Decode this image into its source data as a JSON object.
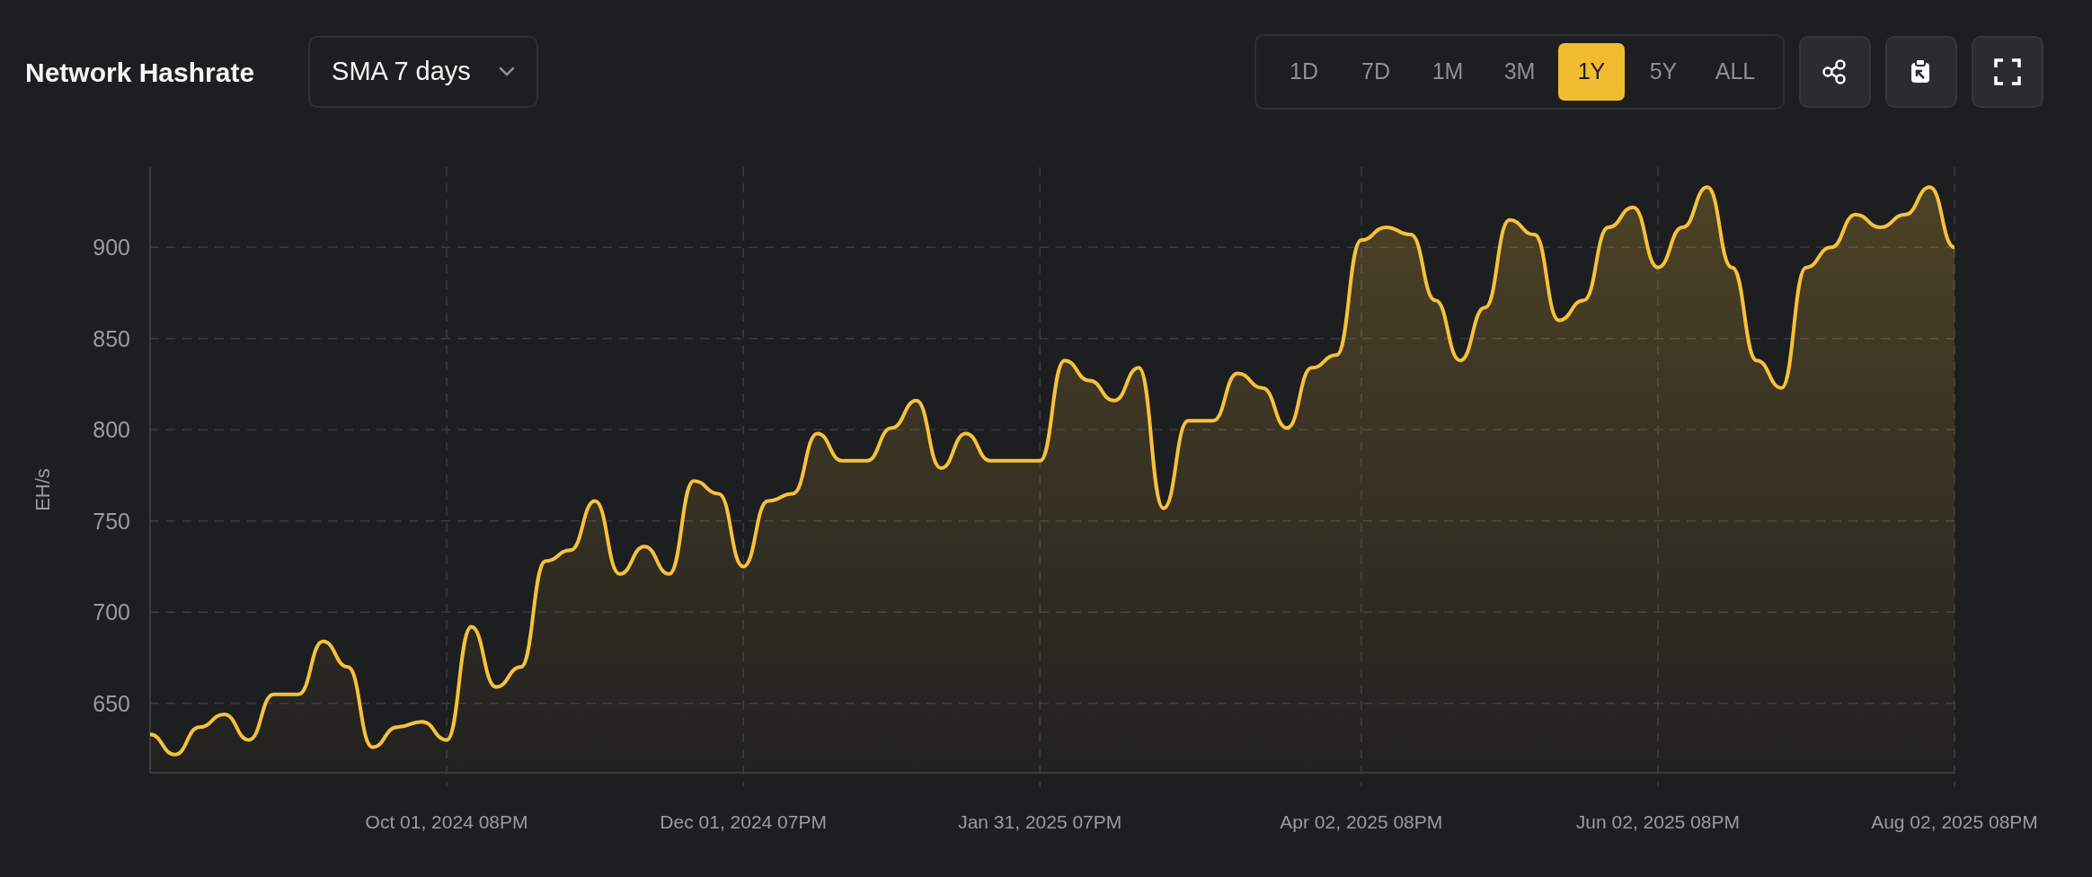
{
  "title": "Network Hashrate",
  "dropdown": {
    "value": "SMA 7 days"
  },
  "ranges": [
    {
      "label": "1D",
      "selected": false
    },
    {
      "label": "7D",
      "selected": false
    },
    {
      "label": "1M",
      "selected": false
    },
    {
      "label": "3M",
      "selected": false
    },
    {
      "label": "1Y",
      "selected": true
    },
    {
      "label": "5Y",
      "selected": false
    },
    {
      "label": "ALL",
      "selected": false
    }
  ],
  "actions": [
    {
      "kind": "share"
    },
    {
      "kind": "clipboard"
    },
    {
      "kind": "fullscreen"
    }
  ],
  "chart_data": {
    "type": "area",
    "ylabel": "EH/s",
    "categories": [
      null,
      null,
      null,
      null,
      null,
      null,
      null,
      null,
      null,
      null,
      null,
      null,
      "Oct 01, 2024 08PM",
      null,
      null,
      null,
      null,
      null,
      null,
      null,
      null,
      null,
      null,
      null,
      "Dec 01, 2024 07PM",
      null,
      null,
      null,
      null,
      null,
      null,
      null,
      null,
      null,
      null,
      null,
      "Jan 31, 2025 07PM",
      null,
      null,
      null,
      null,
      null,
      null,
      null,
      null,
      null,
      null,
      null,
      null,
      "Apr 02, 2025 08PM",
      null,
      null,
      null,
      null,
      null,
      null,
      null,
      null,
      null,
      null,
      null,
      "Jun 02, 2025 08PM",
      null,
      null,
      null,
      null,
      null,
      null,
      null,
      null,
      null,
      null,
      null,
      "Aug 02, 2025 08PM"
    ],
    "series": [
      {
        "color": "#f7c13a",
        "values": [
          633,
          622,
          637,
          644,
          630,
          655,
          655,
          684,
          670,
          626,
          637,
          640,
          630,
          692,
          659,
          670,
          728,
          734,
          761,
          721,
          736,
          721,
          772,
          765,
          725,
          761,
          765,
          798,
          783,
          783,
          801,
          816,
          779,
          798,
          783,
          783,
          783,
          838,
          827,
          816,
          834,
          757,
          805,
          805,
          831,
          823,
          801,
          834,
          841,
          904,
          911,
          907,
          871,
          838,
          867,
          915,
          907,
          860,
          871,
          911,
          922,
          889,
          911,
          933,
          889,
          838,
          823,
          889,
          900,
          918,
          911,
          918,
          933,
          900
        ]
      }
    ],
    "ylim": [
      612,
      944
    ],
    "grid": true,
    "yticks": [
      650,
      700,
      750,
      800,
      850,
      900
    ]
  }
}
